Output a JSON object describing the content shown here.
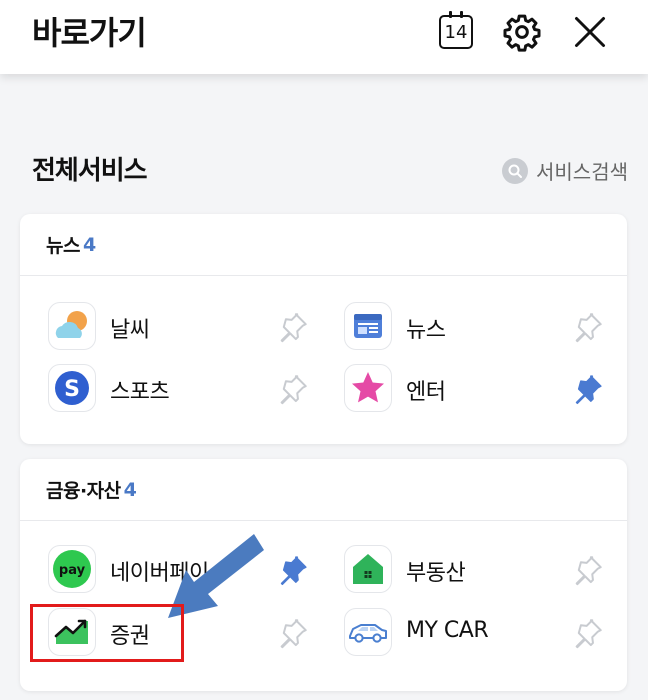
{
  "header": {
    "title": "바로가기",
    "calendar_day": "14",
    "settings_icon": "gear-icon",
    "close_icon": "close-icon"
  },
  "services": {
    "title": "전체서비스",
    "search_label": "서비스검색",
    "search_icon": "search-icon"
  },
  "categories": [
    {
      "name": "뉴스",
      "count": "4",
      "items": [
        {
          "label": "날씨",
          "icon": "weather-icon",
          "pinned": false
        },
        {
          "label": "뉴스",
          "icon": "news-icon",
          "pinned": false
        },
        {
          "label": "스포츠",
          "icon": "sports-icon",
          "pinned": false
        },
        {
          "label": "엔터",
          "icon": "entertainment-star-icon",
          "pinned": true
        }
      ]
    },
    {
      "name": "금융·자산",
      "count": "4",
      "items": [
        {
          "label": "네이버페이",
          "icon": "pay-icon",
          "pinned": true
        },
        {
          "label": "부동산",
          "icon": "real-estate-house-icon",
          "pinned": false
        },
        {
          "label": "증권",
          "icon": "stock-chart-icon",
          "pinned": false
        },
        {
          "label": "MY CAR",
          "icon": "car-icon",
          "pinned": false
        }
      ]
    }
  ],
  "pay_badge": "pay",
  "colors": {
    "accent": "#4a79c6",
    "pin_active": "#4a7ad1",
    "highlight_box": "#e21b1b",
    "annotation_arrow": "#4b7bbf"
  }
}
